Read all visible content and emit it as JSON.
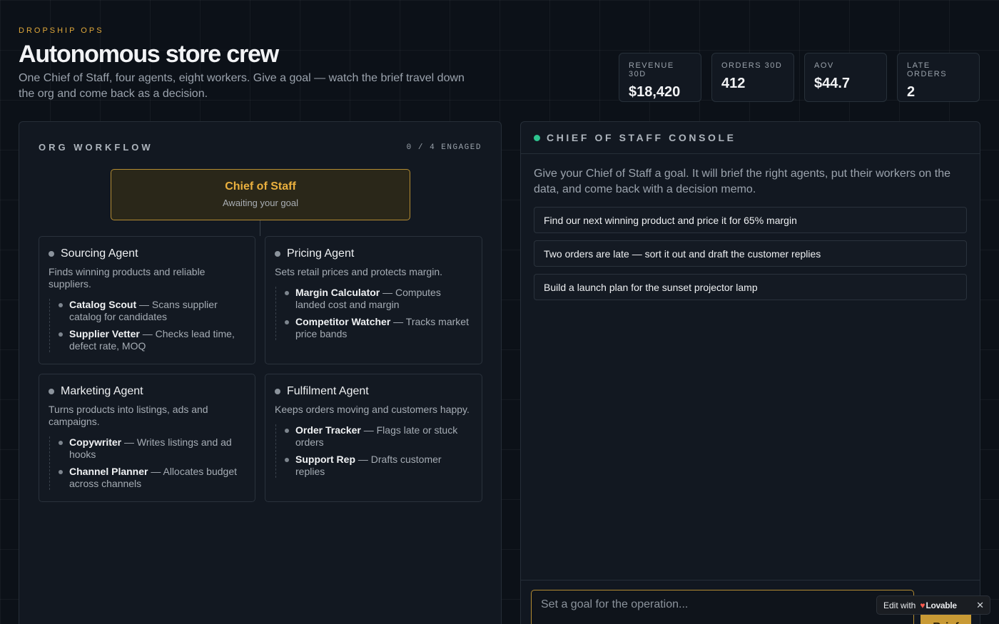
{
  "header": {
    "eyebrow": "DROPSHIP OPS",
    "title": "Autonomous store crew",
    "subtitle": "One Chief of Staff, four agents, eight workers. Give a goal — watch the brief travel down the org and come back as a decision."
  },
  "stats": [
    {
      "label": "REVENUE 30D",
      "value": "$18,420"
    },
    {
      "label": "ORDERS 30D",
      "value": "412"
    },
    {
      "label": "AOV",
      "value": "$44.7"
    },
    {
      "label": "LATE ORDERS",
      "value": "2"
    }
  ],
  "org": {
    "title": "ORG WORKFLOW",
    "engaged": "0 / 4 ENGAGED",
    "chief": {
      "title": "Chief of Staff",
      "status": "Awaiting your goal"
    },
    "agents": [
      {
        "name": "Sourcing Agent",
        "desc": "Finds winning products and reliable suppliers.",
        "workers": [
          {
            "name": "Catalog Scout",
            "desc": " — Scans supplier catalog for candidates"
          },
          {
            "name": "Supplier Vetter",
            "desc": " — Checks lead time, defect rate, MOQ"
          }
        ]
      },
      {
        "name": "Pricing Agent",
        "desc": "Sets retail prices and protects margin.",
        "workers": [
          {
            "name": "Margin Calculator",
            "desc": " — Computes landed cost and margin"
          },
          {
            "name": "Competitor Watcher",
            "desc": " — Tracks market price bands"
          }
        ]
      },
      {
        "name": "Marketing Agent",
        "desc": "Turns products into listings, ads and campaigns.",
        "workers": [
          {
            "name": "Copywriter",
            "desc": " — Writes listings and ad hooks"
          },
          {
            "name": "Channel Planner",
            "desc": " — Allocates budget across channels"
          }
        ]
      },
      {
        "name": "Fulfilment Agent",
        "desc": "Keeps orders moving and customers happy.",
        "workers": [
          {
            "name": "Order Tracker",
            "desc": " — Flags late or stuck orders"
          },
          {
            "name": "Support Rep",
            "desc": " — Drafts customer replies"
          }
        ]
      }
    ]
  },
  "console": {
    "title": "CHIEF OF STAFF CONSOLE",
    "intro": "Give your Chief of Staff a goal. It will brief the right agents, put their workers on the data, and come back with a decision memo.",
    "suggestions": [
      "Find our next winning product and price it for 65% margin",
      "Two orders are late — sort it out and draft the customer replies",
      "Build a launch plan for the sunset projector lamp"
    ],
    "input_placeholder": "Set a goal for the operation...",
    "submit_label": "Brief"
  },
  "badge": {
    "prefix": "Edit with",
    "brand": "Lovable",
    "close": "✕"
  },
  "colors": {
    "accent": "#eab03e",
    "status": "#2ec48f",
    "background": "#0c1118"
  }
}
